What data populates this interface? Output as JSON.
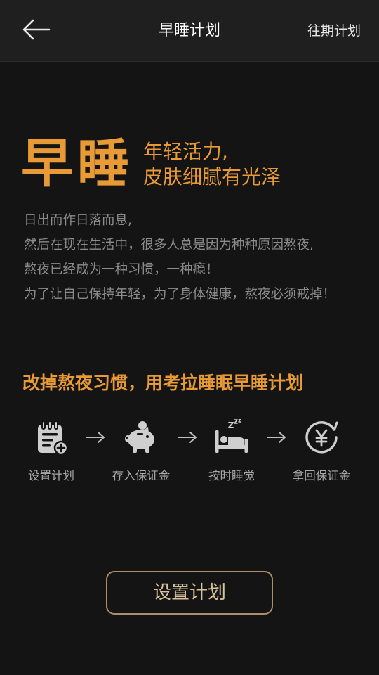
{
  "header": {
    "title": "早睡计划",
    "history_label": "往期计划",
    "back_icon": "arrow-left-icon"
  },
  "hero": {
    "headline": "早睡",
    "tagline_line1": "年轻活力,",
    "tagline_line2": "皮肤细腻有光泽"
  },
  "intro": {
    "lines": [
      "日出而作日落而息,",
      "然后在现在生活中，很多人总是因为种种原因熬夜,",
      "熬夜已经成为一种习惯，一种瘾！",
      "为了让自己保持年轻，为了身体健康，熬夜必须戒掉！"
    ]
  },
  "slogan": "改掉熬夜习惯，用考拉睡眠早睡计划",
  "steps": [
    {
      "label": "设置计划",
      "icon": "plan-notepad-icon"
    },
    {
      "label": "存入保证金",
      "icon": "piggy-bank-icon"
    },
    {
      "label": "按时睡觉",
      "icon": "sleeping-bed-icon"
    },
    {
      "label": "拿回保证金",
      "icon": "yuan-refund-icon"
    }
  ],
  "cta_label": "设置计划",
  "colors": {
    "background": "#141414",
    "header_bg": "#1f1f1f",
    "accent": "#e79a35",
    "icon_gray": "#cfcfcf",
    "muted_text": "#8b8b8b",
    "button_border": "#a98e66"
  }
}
